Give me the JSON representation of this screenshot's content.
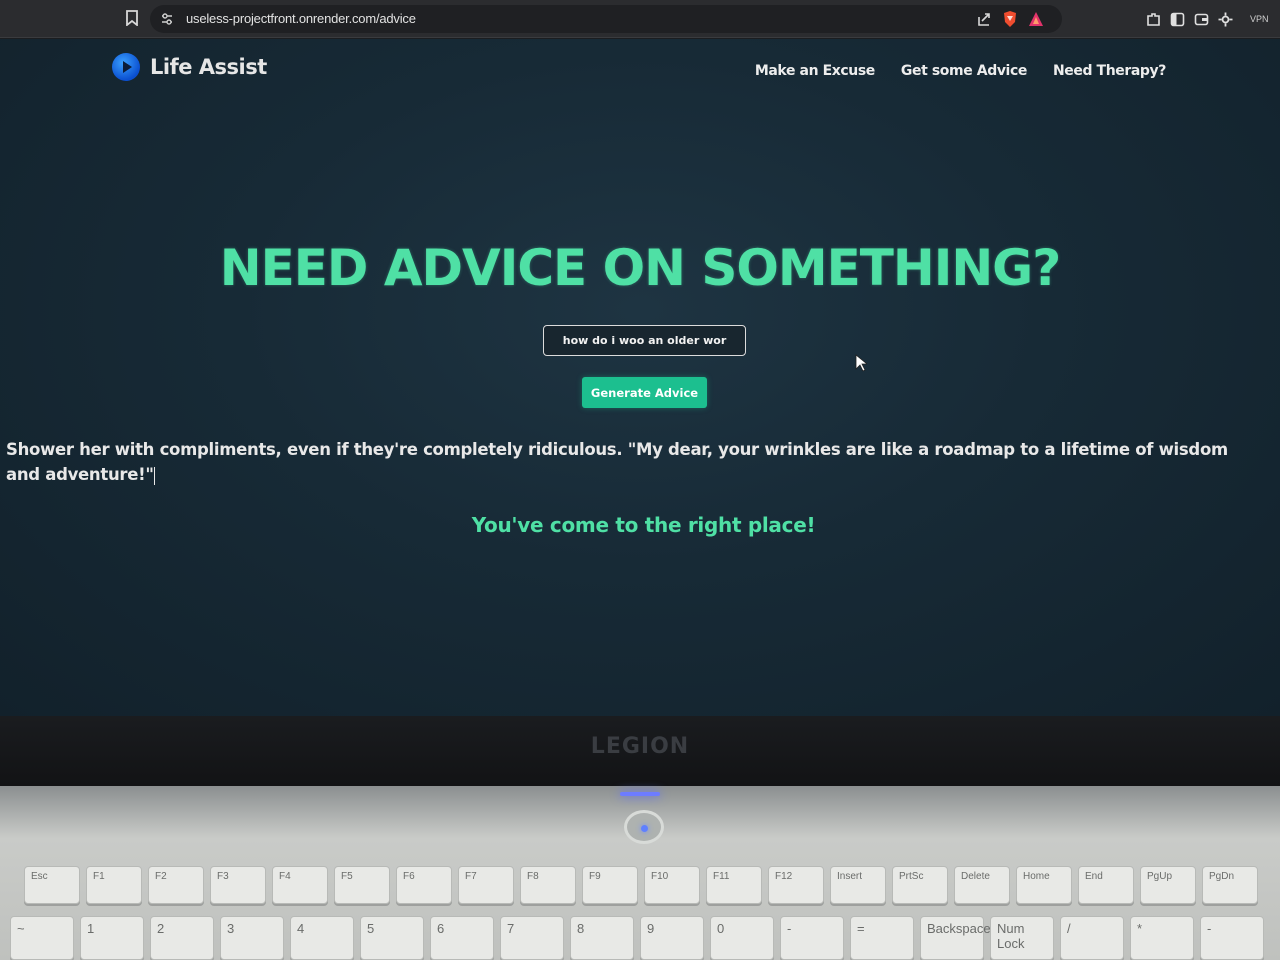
{
  "browser": {
    "url": "useless-projectfront.onrender.com/advice",
    "vpn_label": "VPN"
  },
  "site": {
    "brand_name": "Life Assist",
    "nav": [
      "Make an Excuse",
      "Get some Advice",
      "Need Therapy?"
    ],
    "headline": "NEED ADVICE ON SOMETHING?",
    "input_value": "how do i woo an older wor",
    "button_label": "Generate Advice",
    "advice": "Shower her with compliments, even if they're completely ridiculous. \"My dear, your wrinkles are like a roadmap to a lifetime of wisdom and adventure!\"",
    "tagline": "You've come to the right place!"
  },
  "laptop": {
    "brand": "LEGION",
    "fkeys": [
      "Esc",
      "F1",
      "F2",
      "F3",
      "F4",
      "F5",
      "F6",
      "F7",
      "F8",
      "F9",
      "F10",
      "F11",
      "F12",
      "Insert",
      "PrtSc",
      "Delete",
      "Home",
      "End",
      "PgUp",
      "PgDn"
    ],
    "numkeys": [
      "~",
      "1",
      "2",
      "3",
      "4",
      "5",
      "6",
      "7",
      "8",
      "9",
      "0",
      "-",
      "=",
      "Backspace",
      "Num Lock",
      "/",
      "*",
      "-"
    ]
  },
  "colors": {
    "accent": "#4fe0a5",
    "button": "#1cbf8f",
    "background": "#172a36"
  }
}
